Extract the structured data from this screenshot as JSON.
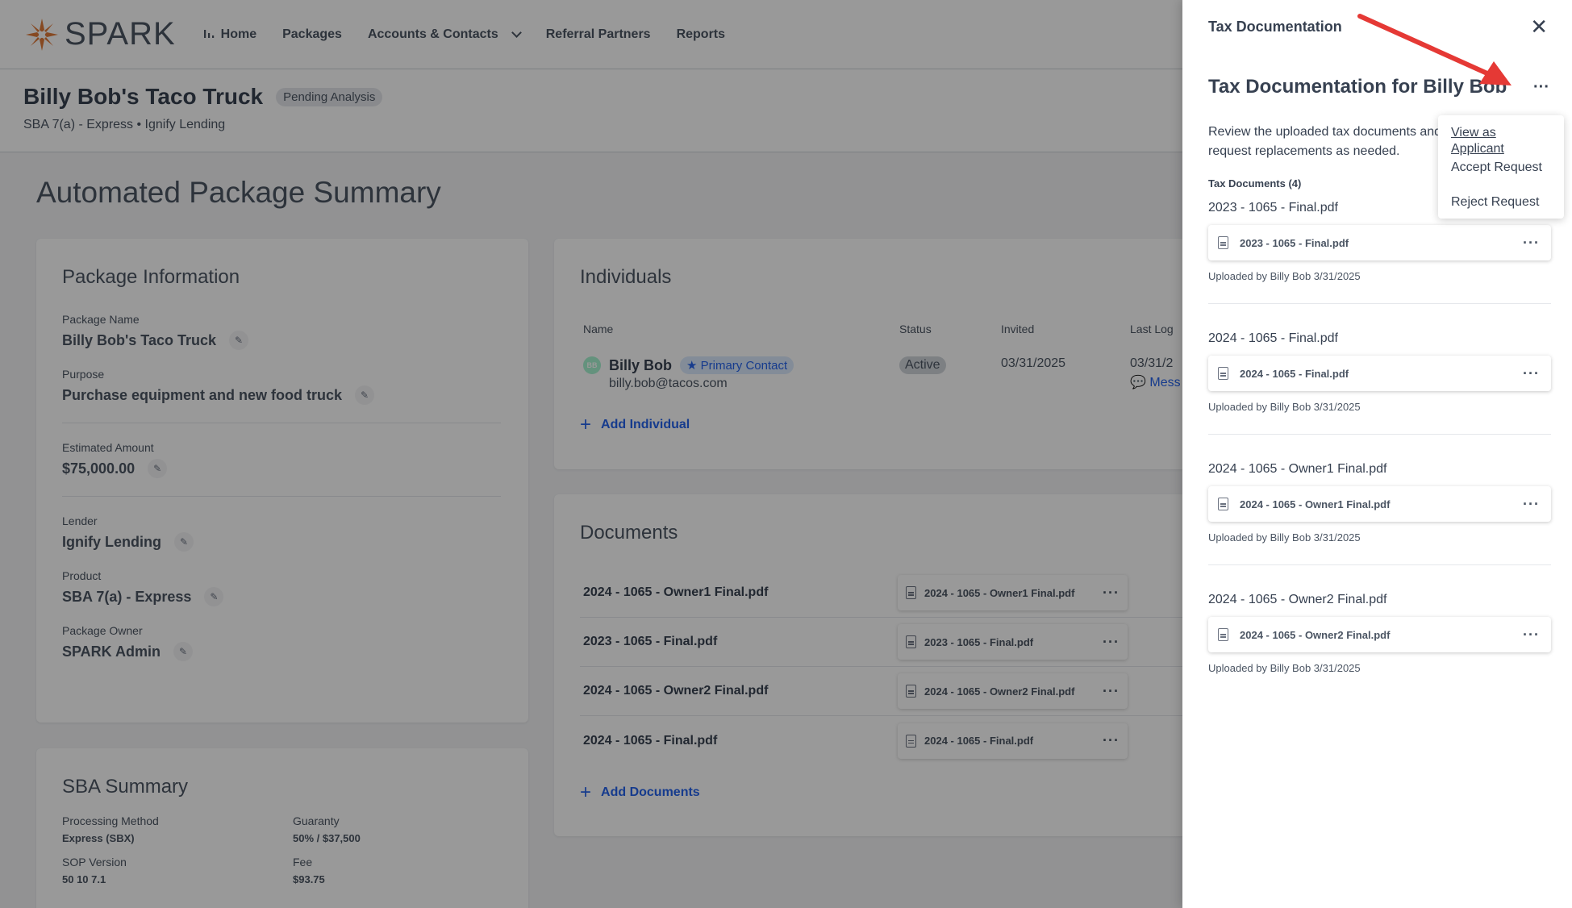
{
  "nav": {
    "brand": "SPARK",
    "items": [
      {
        "label": "Home",
        "icon": "bar-chart-icon"
      },
      {
        "label": "Packages"
      },
      {
        "label": "Accounts & Contacts",
        "dropdown": true
      },
      {
        "label": "Referral Partners"
      },
      {
        "label": "Reports"
      }
    ]
  },
  "header": {
    "title": "Billy Bob's Taco Truck",
    "status": "Pending Analysis",
    "subtitle": "SBA 7(a) - Express • Ignify Lending"
  },
  "summary_title": "Automated Package Summary",
  "package_info": {
    "title": "Package Information",
    "fields": [
      {
        "label": "Package Name",
        "value": "Billy Bob's Taco Truck"
      },
      {
        "label": "Purpose",
        "value": "Purchase equipment and new food truck"
      },
      {
        "label": "Estimated Amount",
        "value": "$75,000.00"
      },
      {
        "label": "Lender",
        "value": "Ignify Lending"
      },
      {
        "label": "Product",
        "value": "SBA 7(a) - Express"
      },
      {
        "label": "Package Owner",
        "value": "SPARK Admin"
      }
    ]
  },
  "sba_summary": {
    "title": "SBA Summary",
    "fields": [
      {
        "label": "Processing Method",
        "value": "Express (SBX)"
      },
      {
        "label": "Guaranty",
        "value": "50% / $37,500"
      },
      {
        "label": "SOP Version",
        "value": "50 10 7.1"
      },
      {
        "label": "Fee",
        "value": "$93.75"
      }
    ]
  },
  "individuals": {
    "title": "Individuals",
    "columns": [
      "Name",
      "Status",
      "Invited",
      "Last Log"
    ],
    "rows": [
      {
        "initials": "BB",
        "name": "Billy Bob",
        "badge": "★ Primary Contact",
        "email": "billy.bob@tacos.com",
        "status": "Active",
        "invited": "03/31/2025",
        "last_login": "03/31/2",
        "message": "Mess"
      }
    ],
    "add_label": "Add Individual"
  },
  "documents": {
    "title": "Documents",
    "rows": [
      {
        "name": "2024 - 1065 - Owner1 Final.pdf",
        "file": "2024 - 1065 - Owner1 Final.pdf"
      },
      {
        "name": "2023 - 1065 - Final.pdf",
        "file": "2023 - 1065 - Final.pdf"
      },
      {
        "name": "2024 - 1065 - Owner2 Final.pdf",
        "file": "2024 - 1065 - Owner2 Final.pdf"
      },
      {
        "name": "2024 - 1065 - Final.pdf",
        "file": "2024 - 1065 - Final.pdf"
      }
    ],
    "add_label": "Add Documents"
  },
  "panel": {
    "header": "Tax Documentation",
    "title": "Tax Documentation for Billy Bob",
    "description": "Review the uploaded tax documents and request replacements as needed.",
    "count_label": "Tax Documents (4)",
    "items": [
      {
        "name": "2023 - 1065 - Final.pdf",
        "file": "2023 - 1065 - Final.pdf",
        "uploaded": "Uploaded by Billy Bob 3/31/2025"
      },
      {
        "name": "2024 - 1065 - Final.pdf",
        "file": "2024 - 1065 - Final.pdf",
        "uploaded": "Uploaded by Billy Bob 3/31/2025"
      },
      {
        "name": "2024 - 1065 - Owner1 Final.pdf",
        "file": "2024 - 1065 - Owner1 Final.pdf",
        "uploaded": "Uploaded by Billy Bob 3/31/2025"
      },
      {
        "name": "2024 - 1065 - Owner2 Final.pdf",
        "file": "2024 - 1065 - Owner2 Final.pdf",
        "uploaded": "Uploaded by Billy Bob 3/31/2025"
      }
    ],
    "menu": [
      "View as Applicant",
      "Accept Request",
      "Reject Request"
    ]
  },
  "colors": {
    "accent_blue": "#2563eb",
    "brand_orange": "#e07b39",
    "annotation_red": "#e53935"
  }
}
